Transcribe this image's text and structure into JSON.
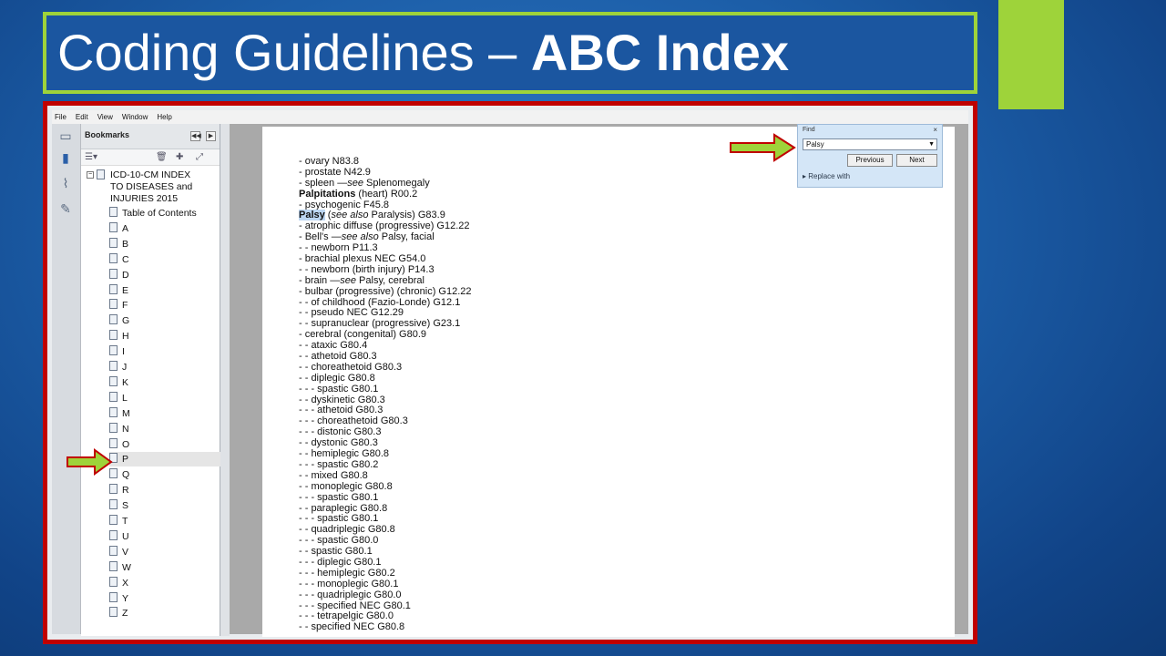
{
  "title": {
    "regular": "Coding Guidelines – ",
    "bold": "ABC Index"
  },
  "menu": [
    "File",
    "Edit",
    "View",
    "Window",
    "Help"
  ],
  "bookmarks": {
    "header": "Bookmarks",
    "root": [
      "ICD-10-CM INDEX",
      "TO DISEASES and",
      "INJURIES 2015"
    ],
    "items": [
      "Table of Contents",
      "A",
      "B",
      "C",
      "D",
      "E",
      "F",
      "G",
      "H",
      "I",
      "J",
      "K",
      "L",
      "M",
      "N",
      "O",
      "P",
      "Q",
      "R",
      "S",
      "T",
      "U",
      "V",
      "W",
      "X",
      "Y",
      "Z"
    ],
    "selected": "P"
  },
  "find": {
    "label": "Find",
    "close": "×",
    "value": "Palsy",
    "previous": "Previous",
    "next": "Next",
    "replace": "Replace with"
  },
  "document": {
    "lines": [
      {
        "t": "- ovary N83.8"
      },
      {
        "t": "- prostate N42.9"
      },
      {
        "t": "- spleen —",
        "i": "see",
        "r": " Splenomegaly"
      },
      {
        "b": "Palpitations",
        "r": " (heart) R00.2"
      },
      {
        "t": "- psychogenic F45.8"
      },
      {
        "hl": "Palsy",
        "r": " (",
        "i": "see also",
        "r2": " Paralysis) G83.9"
      },
      {
        "t": "- atrophic diffuse (progressive) G12.22"
      },
      {
        "t": "- Bell's —",
        "i": "see also",
        "r": " Palsy, facial"
      },
      {
        "t": "- - newborn P11.3"
      },
      {
        "t": "- brachial plexus NEC G54.0"
      },
      {
        "t": "- - newborn (birth injury) P14.3"
      },
      {
        "t": "- brain —",
        "i": "see",
        "r": " Palsy, cerebral"
      },
      {
        "t": "- bulbar (progressive) (chronic) G12.22"
      },
      {
        "t": "- - of childhood (Fazio-Londe) G12.1"
      },
      {
        "t": "- - pseudo NEC G12.29"
      },
      {
        "t": "- - supranuclear (progressive) G23.1"
      },
      {
        "t": "- cerebral (congenital) G80.9"
      },
      {
        "t": "- - ataxic G80.4"
      },
      {
        "t": "- - athetoid G80.3"
      },
      {
        "t": "- - choreathetoid G80.3"
      },
      {
        "t": "- - diplegic G80.8"
      },
      {
        "t": "- - - spastic G80.1"
      },
      {
        "t": "- - dyskinetic G80.3"
      },
      {
        "t": "- - - athetoid G80.3"
      },
      {
        "t": "- - - choreathetoid G80.3"
      },
      {
        "t": "- - - distonic G80.3"
      },
      {
        "t": "- - dystonic G80.3"
      },
      {
        "t": "- - hemiplegic G80.8"
      },
      {
        "t": "- - - spastic G80.2"
      },
      {
        "t": "- - mixed G80.8"
      },
      {
        "t": "- - monoplegic G80.8"
      },
      {
        "t": "- - - spastic G80.1"
      },
      {
        "t": "- - paraplegic G80.8"
      },
      {
        "t": "- - - spastic G80.1"
      },
      {
        "t": "- - quadriplegic G80.8"
      },
      {
        "t": "- - - spastic G80.0"
      },
      {
        "t": "- - spastic G80.1"
      },
      {
        "t": "- - - diplegic G80.1"
      },
      {
        "t": "- - - hemiplegic G80.2"
      },
      {
        "t": "- - - monoplegic G80.1"
      },
      {
        "t": "- - - quadriplegic G80.0"
      },
      {
        "t": "- - - specified NEC G80.1"
      },
      {
        "t": "- - - tetrapelgic G80.0"
      },
      {
        "t": "- - specified NEC G80.8"
      }
    ]
  },
  "colors": {
    "accent_green": "#9ed33a",
    "frame_red": "#c00000",
    "background_blue": "#1c5ea8"
  }
}
